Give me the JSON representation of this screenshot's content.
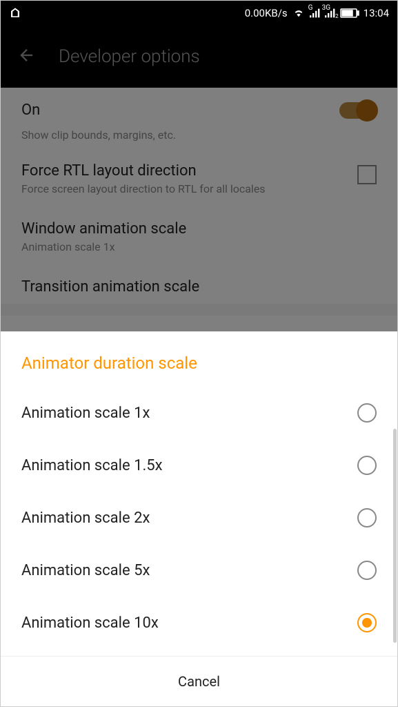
{
  "status_bar": {
    "data_rate": "0.00KB/s",
    "time": "13:04"
  },
  "header": {
    "title": "Developer options"
  },
  "background_settings": {
    "on_label": "On",
    "show_bounds_desc": "Show clip bounds, margins, etc.",
    "rtl_title": "Force RTL layout direction",
    "rtl_desc": "Force screen layout direction to RTL for all locales",
    "window_anim_title": "Window animation scale",
    "window_anim_desc": "Animation scale 1x",
    "transition_title": "Transition animation scale"
  },
  "dialog": {
    "title": "Animator duration scale",
    "options": [
      {
        "label": "Animation scale 1x",
        "selected": false
      },
      {
        "label": "Animation scale 1.5x",
        "selected": false
      },
      {
        "label": "Animation scale 2x",
        "selected": false
      },
      {
        "label": "Animation scale 5x",
        "selected": false
      },
      {
        "label": "Animation scale 10x",
        "selected": true
      }
    ],
    "cancel_label": "Cancel"
  }
}
